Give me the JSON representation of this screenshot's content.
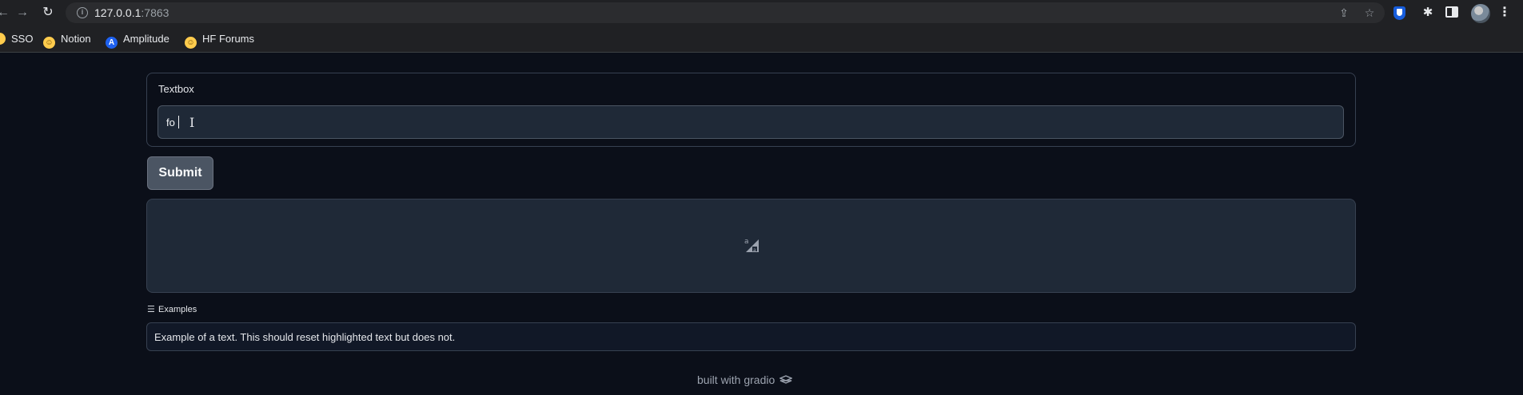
{
  "browser": {
    "url_host": "127.0.0.1",
    "url_port": ":7863",
    "bookmarks": [
      {
        "label": "SSO"
      },
      {
        "label": "Notion"
      },
      {
        "label": "Amplitude"
      },
      {
        "label": "HF Forums"
      }
    ]
  },
  "app": {
    "textbox": {
      "label": "Textbox",
      "value": "fo"
    },
    "submit_label": "Submit",
    "examples": {
      "header": "Examples",
      "items": [
        "Example of a text. This should reset highlighted text but does not."
      ]
    },
    "footer": "built with gradio"
  }
}
